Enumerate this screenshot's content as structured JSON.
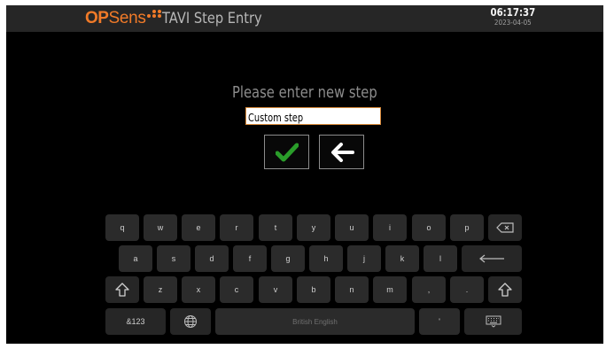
{
  "header": {
    "logo_op": "OP",
    "logo_sens": "Sens",
    "title": "TAVI Step Entry",
    "time": "06:17:37",
    "date": "2023-04-05"
  },
  "dialog": {
    "prompt": "Please enter new step",
    "input_value": "Custom step",
    "confirm_icon": "checkmark-icon",
    "back_icon": "arrow-left-icon"
  },
  "keyboard": {
    "row1": [
      "q",
      "w",
      "e",
      "r",
      "t",
      "y",
      "u",
      "i",
      "o",
      "p"
    ],
    "row2": [
      "a",
      "s",
      "d",
      "f",
      "g",
      "h",
      "j",
      "k",
      "l"
    ],
    "row3": [
      "z",
      "x",
      "c",
      "v",
      "b",
      "n",
      "m",
      ",",
      "."
    ],
    "symbols_label": "&123",
    "space_label": "British English",
    "apostrophe": "'",
    "icons": {
      "backspace": "backspace-icon",
      "enter": "enter-icon",
      "shift_left": "shift-icon",
      "shift_right": "shift-icon",
      "globe": "globe-icon",
      "hide_keyboard": "keyboard-hide-icon"
    }
  },
  "colors": {
    "brand_orange": "#f07a28",
    "confirm_green": "#2a9d2a",
    "screen_bg": "#000000",
    "key_bg": "#2b2b2b"
  }
}
